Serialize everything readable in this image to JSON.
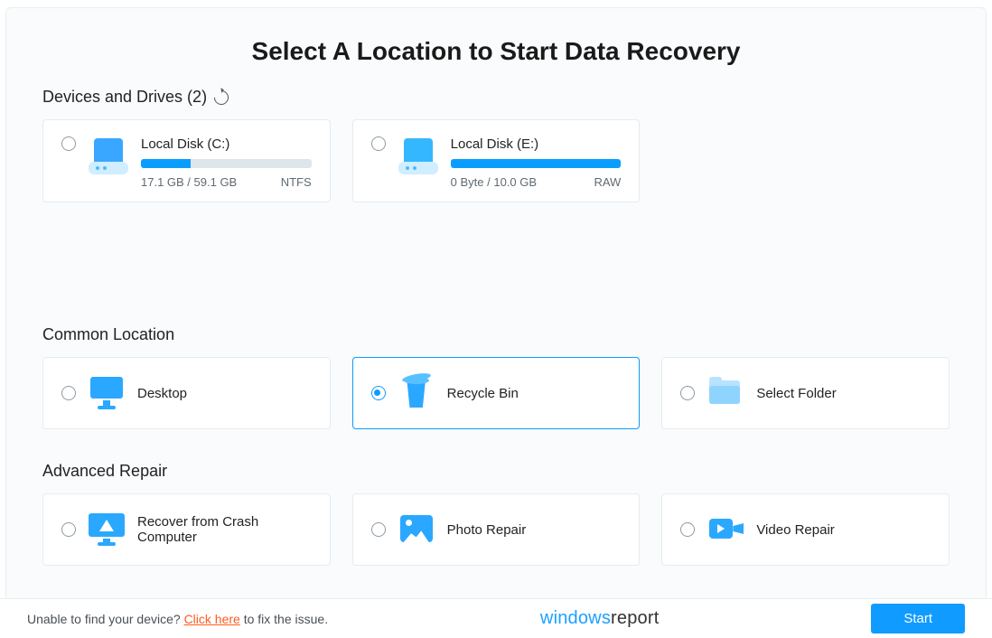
{
  "title": "Select A Location to Start Data Recovery",
  "sections": {
    "devices": {
      "heading": "Devices and Drives (2)",
      "drives": [
        {
          "name": "Local Disk (C:)",
          "usage_label": "17.1 GB / 59.1 GB",
          "fs": "NTFS",
          "fill_pct": 29,
          "selected": false
        },
        {
          "name": "Local Disk (E:)",
          "usage_label": "0 Byte / 10.0 GB",
          "fs": "RAW",
          "fill_pct": 100,
          "selected": false
        }
      ]
    },
    "common": {
      "heading": "Common Location",
      "options": [
        {
          "label": "Desktop",
          "icon": "monitor",
          "selected": false
        },
        {
          "label": "Recycle Bin",
          "icon": "bin",
          "selected": true
        },
        {
          "label": "Select Folder",
          "icon": "folder",
          "selected": false
        }
      ]
    },
    "advanced": {
      "heading": "Advanced Repair",
      "options": [
        {
          "label": "Recover from Crash Computer",
          "icon": "crash",
          "selected": false
        },
        {
          "label": "Photo Repair",
          "icon": "photo",
          "selected": false
        },
        {
          "label": "Video Repair",
          "icon": "video",
          "selected": false
        }
      ]
    }
  },
  "footer": {
    "help_pre": "Unable to find your device? ",
    "help_link": "Click here",
    "help_post": " to fix the issue.",
    "brand_w": "windows",
    "brand_rest": "report",
    "start_label": "Start"
  }
}
